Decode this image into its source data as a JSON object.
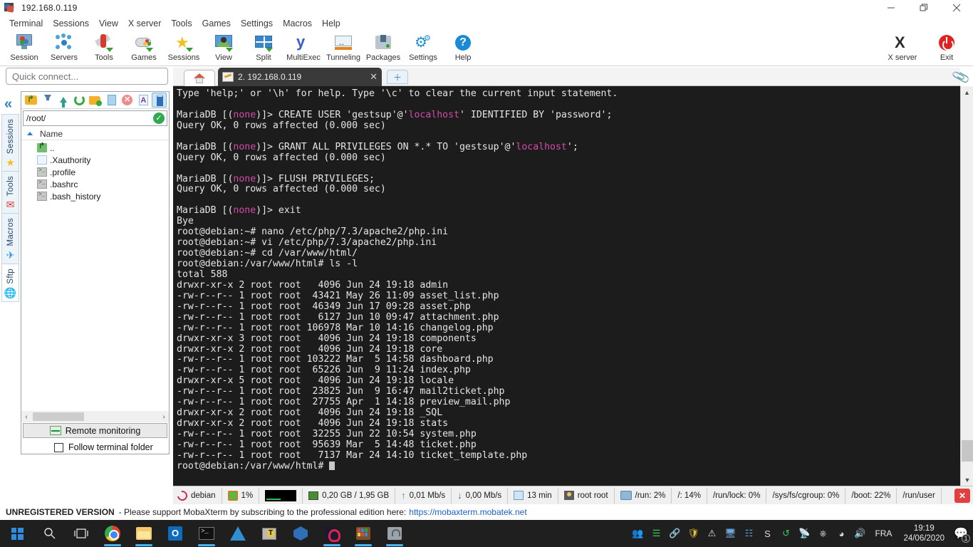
{
  "window": {
    "title": "192.168.0.119",
    "icon": "mobaxterm-icon",
    "controls": {
      "minimize": "—",
      "maximize": "❐",
      "close": "✕"
    }
  },
  "menubar": {
    "items": [
      "Terminal",
      "Sessions",
      "View",
      "X server",
      "Tools",
      "Games",
      "Settings",
      "Macros",
      "Help"
    ]
  },
  "ribbon": {
    "items": [
      {
        "label": "Session",
        "icon": "session-icon"
      },
      {
        "label": "Servers",
        "icon": "servers-icon"
      },
      {
        "label": "Tools",
        "icon": "tools-icon"
      },
      {
        "label": "Games",
        "icon": "games-icon"
      },
      {
        "label": "Sessions",
        "icon": "sessions-star-icon"
      },
      {
        "label": "View",
        "icon": "view-icon"
      },
      {
        "label": "Split",
        "icon": "split-icon"
      },
      {
        "label": "MultiExec",
        "icon": "multiexec-icon"
      },
      {
        "label": "Tunneling",
        "icon": "tunneling-icon"
      },
      {
        "label": "Packages",
        "icon": "packages-icon"
      },
      {
        "label": "Settings",
        "icon": "settings-gear-icon"
      },
      {
        "label": "Help",
        "icon": "help-icon"
      }
    ],
    "right_items": [
      {
        "label": "X server",
        "icon": "x-server-icon"
      },
      {
        "label": "Exit",
        "icon": "power-exit-icon"
      }
    ]
  },
  "quick_connect": {
    "placeholder": "Quick connect...",
    "value": ""
  },
  "side_tabs": [
    {
      "label": "Sessions",
      "icon": "star-icon",
      "active": false
    },
    {
      "label": "Tools",
      "icon": "knife-icon",
      "active": false
    },
    {
      "label": "Macros",
      "icon": "paper-plane-icon",
      "active": false
    },
    {
      "label": "Sftp",
      "icon": "globe-icon",
      "active": true
    }
  ],
  "collapse_button": "«",
  "file_panel": {
    "toolbar": [
      {
        "name": "parent-folder-icon",
        "selected": false
      },
      {
        "name": "download-icon",
        "selected": false
      },
      {
        "name": "upload-icon",
        "selected": false
      },
      {
        "name": "refresh-icon",
        "selected": false
      },
      {
        "name": "new-folder-icon",
        "selected": false
      },
      {
        "name": "new-file-icon",
        "selected": false
      },
      {
        "name": "delete-icon",
        "selected": false
      },
      {
        "name": "text-edit-icon",
        "selected": false
      },
      {
        "name": "usb-drive-icon",
        "selected": true
      }
    ],
    "path": "/root/",
    "path_ok": "✓",
    "column_header": "Name",
    "entries": [
      {
        "name": "..",
        "icon": "parent-dir-icon"
      },
      {
        "name": ".Xauthority",
        "icon": "file-icon"
      },
      {
        "name": ".profile",
        "icon": "script-icon"
      },
      {
        "name": ".bashrc",
        "icon": "script-icon"
      },
      {
        "name": ".bash_history",
        "icon": "script-icon"
      }
    ],
    "remote_monitoring_label": "Remote monitoring",
    "follow_terminal_label": "Follow terminal folder",
    "follow_terminal_checked": false,
    "scroll_left": "‹",
    "scroll_right": "›"
  },
  "tabs": {
    "home_icon": "home-icon",
    "active_tab": "2. 192.168.0.119",
    "close_label": "✕",
    "new_tab_label": "＋",
    "attach_icon": "paperclip-icon"
  },
  "terminal": {
    "lines": [
      [
        {
          "t": "Type 'help;' or '\\h' for help. Type '\\c' to clear the current input statement.",
          "c": "w"
        }
      ],
      [],
      [
        {
          "t": "MariaDB [(",
          "c": "w"
        },
        {
          "t": "none",
          "c": "m"
        },
        {
          "t": ")]> CREATE USER 'gestsup'@'",
          "c": "w"
        },
        {
          "t": "localhost",
          "c": "m"
        },
        {
          "t": "' IDENTIFIED BY 'password';",
          "c": "w"
        }
      ],
      [
        {
          "t": "Query OK, 0 rows affected (0.000 sec)",
          "c": "w"
        }
      ],
      [],
      [
        {
          "t": "MariaDB [(",
          "c": "w"
        },
        {
          "t": "none",
          "c": "m"
        },
        {
          "t": ")]> GRANT ALL PRIVILEGES ON *.* TO 'gestsup'@'",
          "c": "w"
        },
        {
          "t": "localhost",
          "c": "m"
        },
        {
          "t": "';",
          "c": "w"
        }
      ],
      [
        {
          "t": "Query OK, 0 rows affected (0.000 sec)",
          "c": "w"
        }
      ],
      [],
      [
        {
          "t": "MariaDB [(",
          "c": "w"
        },
        {
          "t": "none",
          "c": "m"
        },
        {
          "t": ")]> FLUSH PRIVILEGES;",
          "c": "w"
        }
      ],
      [
        {
          "t": "Query OK, 0 rows affected (0.000 sec)",
          "c": "w"
        }
      ],
      [],
      [
        {
          "t": "MariaDB [(",
          "c": "w"
        },
        {
          "t": "none",
          "c": "m"
        },
        {
          "t": ")]> exit",
          "c": "w"
        }
      ],
      [
        {
          "t": "Bye",
          "c": "w"
        }
      ],
      [
        {
          "t": "root@debian:~# nano /etc/php/7.3/apache2/php.ini",
          "c": "w"
        }
      ],
      [
        {
          "t": "root@debian:~# vi /etc/php/7.3/apache2/php.ini",
          "c": "w"
        }
      ],
      [
        {
          "t": "root@debian:~# cd /var/www/html/",
          "c": "w"
        }
      ],
      [
        {
          "t": "root@debian:/var/www/html# ls -l",
          "c": "w"
        }
      ],
      [
        {
          "t": "total 588",
          "c": "w"
        }
      ],
      [
        {
          "t": "drwxr-xr-x 2 root root   4096 Jun 24 19:18 admin",
          "c": "w"
        }
      ],
      [
        {
          "t": "-rw-r--r-- 1 root root  43421 May 26 11:09 asset_list.php",
          "c": "w"
        }
      ],
      [
        {
          "t": "-rw-r--r-- 1 root root  46349 Jun 17 09:28 asset.php",
          "c": "w"
        }
      ],
      [
        {
          "t": "-rw-r--r-- 1 root root   6127 Jun 10 09:47 attachment.php",
          "c": "w"
        }
      ],
      [
        {
          "t": "-rw-r--r-- 1 root root 106978 Mar 10 14:16 changelog.php",
          "c": "w"
        }
      ],
      [
        {
          "t": "drwxr-xr-x 3 root root   4096 Jun 24 19:18 components",
          "c": "w"
        }
      ],
      [
        {
          "t": "drwxr-xr-x 2 root root   4096 Jun 24 19:18 core",
          "c": "w"
        }
      ],
      [
        {
          "t": "-rw-r--r-- 1 root root 103222 Mar  5 14:58 dashboard.php",
          "c": "w"
        }
      ],
      [
        {
          "t": "-rw-r--r-- 1 root root  65226 Jun  9 11:24 index.php",
          "c": "w"
        }
      ],
      [
        {
          "t": "drwxr-xr-x 5 root root   4096 Jun 24 19:18 locale",
          "c": "w"
        }
      ],
      [
        {
          "t": "-rw-r--r-- 1 root root  23825 Jun  9 16:47 mail2ticket.php",
          "c": "w"
        }
      ],
      [
        {
          "t": "-rw-r--r-- 1 root root  27755 Apr  1 14:18 preview_mail.php",
          "c": "w"
        }
      ],
      [
        {
          "t": "drwxr-xr-x 2 root root   4096 Jun 24 19:18 _SQL",
          "c": "w"
        }
      ],
      [
        {
          "t": "drwxr-xr-x 2 root root   4096 Jun 24 19:18 stats",
          "c": "w"
        }
      ],
      [
        {
          "t": "-rw-r--r-- 1 root root  32255 Jun 22 10:54 system.php",
          "c": "w"
        }
      ],
      [
        {
          "t": "-rw-r--r-- 1 root root  95639 Mar  5 14:48 ticket.php",
          "c": "w"
        }
      ],
      [
        {
          "t": "-rw-r--r-- 1 root root   7137 Mar 24 14:10 ticket_template.php",
          "c": "w"
        }
      ],
      [
        {
          "t": "root@debian:/var/www/html# ",
          "c": "w",
          "cursor": true
        }
      ]
    ],
    "colors": {
      "background": "#1c1c1c",
      "foreground": "#e6e6e6",
      "magenta": "#d44ba8"
    }
  },
  "status_bar": {
    "cells": [
      {
        "icon": "debian-icon",
        "label": "debian"
      },
      {
        "icon": "cpu-icon",
        "label": "1%"
      },
      {
        "icon": "cpu-graph",
        "label": ""
      },
      {
        "icon": "ram-icon",
        "label": "0,20 GB / 1,95 GB"
      },
      {
        "icon": "upload-arrow-icon",
        "label": "0,01 Mb/s"
      },
      {
        "icon": "download-arrow-icon",
        "label": "0,00 Mb/s"
      },
      {
        "icon": "uptime-icon",
        "label": "13 min"
      },
      {
        "icon": "user-icon",
        "label": "root root"
      },
      {
        "icon": "disk-icon",
        "label": "/run: 2%"
      },
      {
        "icon": "",
        "label": "/: 14%"
      },
      {
        "icon": "",
        "label": "/run/lock: 0%"
      },
      {
        "icon": "",
        "label": "/sys/fs/cgroup: 0%"
      },
      {
        "icon": "",
        "label": "/boot: 22%"
      },
      {
        "icon": "",
        "label": "/run/user"
      }
    ],
    "close_label": "✕"
  },
  "unregistered": {
    "badge": "UNREGISTERED VERSION",
    "message": "-  Please support MobaXterm by subscribing to the professional edition here:",
    "link": "https://mobaxterm.mobatek.net"
  },
  "taskbar": {
    "start_icon": "windows-start-icon",
    "pinned": [
      {
        "name": "search-icon",
        "running": false
      },
      {
        "name": "task-view-icon",
        "running": false
      },
      {
        "name": "chrome-icon",
        "running": true
      },
      {
        "name": "file-explorer-icon",
        "running": true
      },
      {
        "name": "outlook-icon",
        "running": false
      },
      {
        "name": "mobaxterm-icon",
        "running": true
      },
      {
        "name": "vscode-icon",
        "running": false
      },
      {
        "name": "teraterm-icon",
        "running": false
      },
      {
        "name": "virtualbox-icon",
        "running": false
      },
      {
        "name": "camtasia-icon",
        "running": true
      },
      {
        "name": "winrar-icon",
        "running": true
      },
      {
        "name": "lock-icon",
        "running": true
      }
    ],
    "tray": [
      "people-icon",
      "network-share-icon",
      "link-icon",
      "shield-icon",
      "security-warning-icon",
      "display-icon",
      "network-map-icon",
      "s-icon",
      "sync-icon",
      "satellite-icon",
      "usb-eject-icon",
      "wifi-icon",
      "volume-icon"
    ],
    "language": "FRA",
    "clock_time": "19:19",
    "clock_date": "24/06/2020",
    "notification_count": "1"
  }
}
